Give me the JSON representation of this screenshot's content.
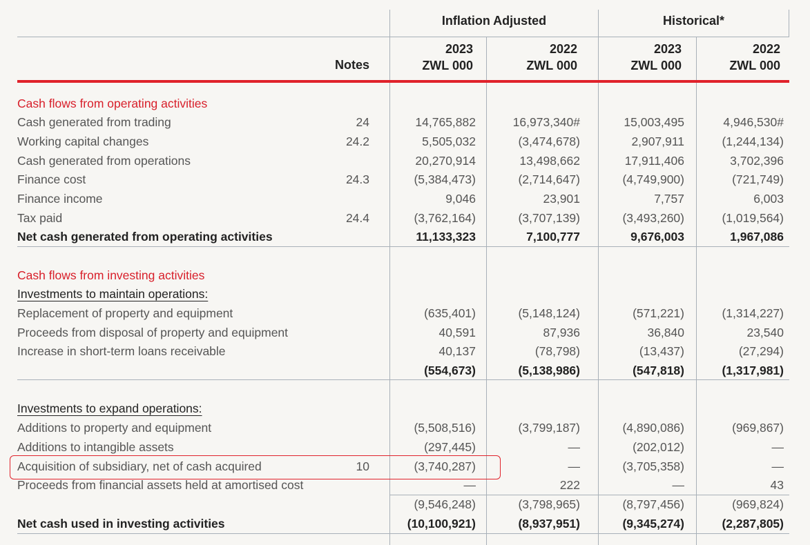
{
  "header": {
    "group_inflation": "Inflation Adjusted",
    "group_historical": "Historical*",
    "notes": "Notes",
    "columns": [
      {
        "year": "2023",
        "unit": "ZWL 000"
      },
      {
        "year": "2022",
        "unit": "ZWL 000"
      },
      {
        "year": "2023",
        "unit": "ZWL 000"
      },
      {
        "year": "2022",
        "unit": "ZWL 000"
      }
    ]
  },
  "rows": [
    {
      "label": "Cash flows from operating activities",
      "notes": "",
      "v": [
        "",
        "",
        "",
        ""
      ]
    },
    {
      "label": "Cash generated from trading",
      "notes": "24",
      "v": [
        "14,765,882",
        "16,973,340#",
        "15,003,495",
        "4,946,530#"
      ]
    },
    {
      "label": "Working capital changes",
      "notes": "24.2",
      "v": [
        "5,505,032",
        "(3,474,678)",
        "2,907,911",
        "(1,244,134)"
      ]
    },
    {
      "label": "Cash generated from operations",
      "notes": "",
      "v": [
        "20,270,914",
        "13,498,662",
        "17,911,406",
        "3,702,396"
      ]
    },
    {
      "label": "Finance cost",
      "notes": "24.3",
      "v": [
        "(5,384,473)",
        "(2,714,647)",
        "(4,749,900)",
        "(721,749)"
      ]
    },
    {
      "label": "Finance income",
      "notes": "",
      "v": [
        "9,046",
        "23,901",
        "7,757",
        "6,003"
      ]
    },
    {
      "label": "Tax paid",
      "notes": "24.4",
      "v": [
        "(3,762,164)",
        "(3,707,139)",
        "(3,493,260)",
        "(1,019,564)"
      ]
    },
    {
      "label": "Net cash generated from operating activities",
      "notes": "",
      "v": [
        "11,133,323",
        "7,100,777",
        "9,676,003",
        "1,967,086"
      ]
    },
    {
      "label": "Cash flows from investing activities",
      "notes": "",
      "v": [
        "",
        "",
        "",
        ""
      ]
    },
    {
      "label": "Investments to maintain operations:",
      "notes": "",
      "v": [
        "",
        "",
        "",
        ""
      ]
    },
    {
      "label": "Replacement of property and equipment",
      "notes": "",
      "v": [
        "(635,401)",
        "(5,148,124)",
        "(571,221)",
        "(1,314,227)"
      ]
    },
    {
      "label": "Proceeds from disposal of property and equipment",
      "notes": "",
      "v": [
        "40,591",
        "87,936",
        "36,840",
        "23,540"
      ]
    },
    {
      "label": "Increase in short-term loans receivable",
      "notes": "",
      "v": [
        "40,137",
        "(78,798)",
        "(13,437)",
        "(27,294)"
      ]
    },
    {
      "label": "",
      "notes": "",
      "v": [
        "(554,673)",
        "(5,138,986)",
        "(547,818)",
        "(1,317,981)"
      ]
    },
    {
      "label": "Investments to expand operations:",
      "notes": "",
      "v": [
        "",
        "",
        "",
        ""
      ]
    },
    {
      "label": "Additions to property and equipment",
      "notes": "",
      "v": [
        "(5,508,516)",
        "(3,799,187)",
        "(4,890,086)",
        "(969,867)"
      ]
    },
    {
      "label": "Additions to intangible assets",
      "notes": "",
      "v": [
        "(297,445)",
        "—",
        "(202,012)",
        "—"
      ]
    },
    {
      "label": "Acquisition of subsidiary, net of cash acquired",
      "notes": "10",
      "v": [
        "(3,740,287)",
        "—",
        "(3,705,358)",
        "—"
      ]
    },
    {
      "label": "Proceeds from financial assets held at amortised cost",
      "notes": "",
      "v": [
        "—",
        "222",
        "—",
        "43"
      ]
    },
    {
      "label": "",
      "notes": "",
      "v": [
        "(9,546,248)",
        "(3,798,965)",
        "(8,797,456)",
        "(969,824)"
      ]
    },
    {
      "label": "Net cash used in investing activities",
      "notes": "",
      "v": [
        "(10,100,921)",
        "(8,937,951)",
        "(9,345,274)",
        "(2,287,805)"
      ]
    }
  ]
}
